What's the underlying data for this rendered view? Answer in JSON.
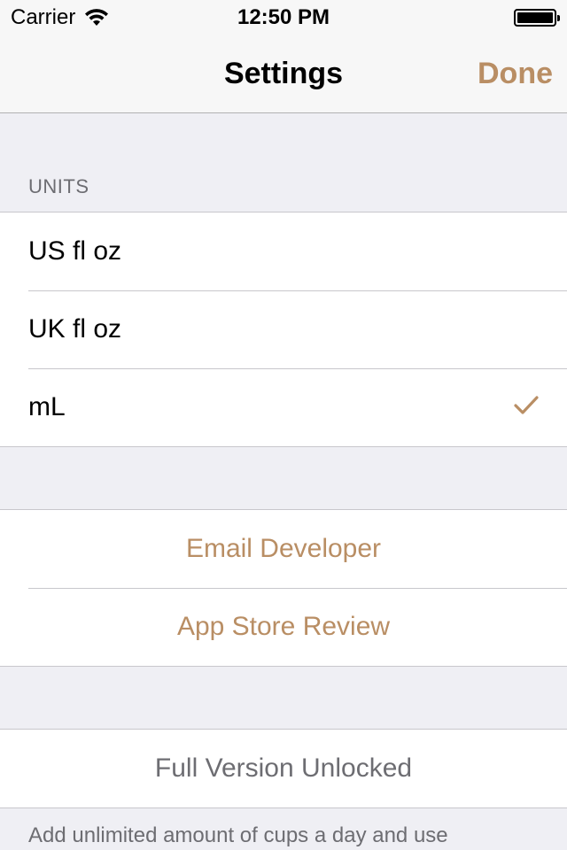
{
  "status_bar": {
    "carrier": "Carrier",
    "time": "12:50 PM"
  },
  "nav": {
    "title": "Settings",
    "done_label": "Done",
    "accent_color": "#b98e64"
  },
  "units_section": {
    "header": "UNITS",
    "options": [
      {
        "label": "US fl oz",
        "selected": false
      },
      {
        "label": "UK fl oz",
        "selected": false
      },
      {
        "label": "mL",
        "selected": true
      }
    ]
  },
  "support_section": {
    "email_label": "Email Developer",
    "review_label": "App Store Review"
  },
  "purchase_section": {
    "status_label": "Full Version Unlocked",
    "footer": "Add unlimited amount of cups a day and use"
  }
}
